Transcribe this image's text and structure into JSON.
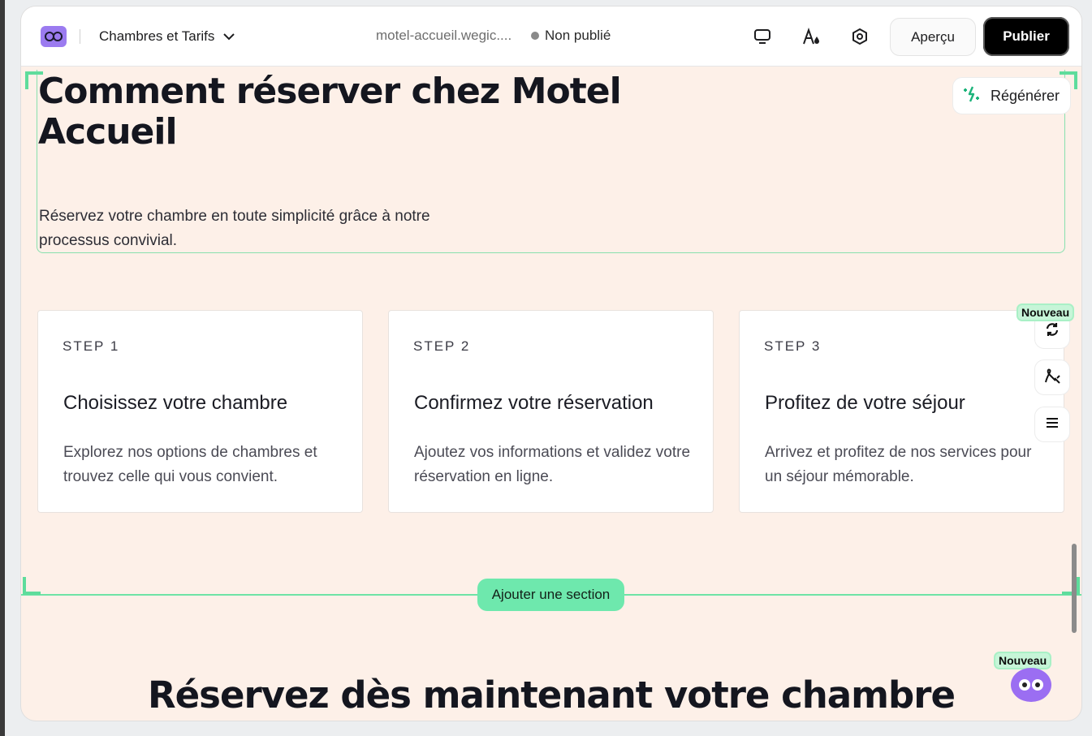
{
  "topbar": {
    "page_name": "Chambres et Tarifs",
    "url": "motel-accueil.wegic....",
    "status": "Non publié",
    "preview_label": "Aperçu",
    "publish_label": "Publier"
  },
  "hero": {
    "title": "Comment réserver chez Motel Accueil",
    "subtitle": "Réservez votre chambre en toute simplicité grâce à notre processus convivial.",
    "regenerate_label": "Régénérer"
  },
  "steps": [
    {
      "step": "STEP 1",
      "title": "Choisissez votre chambre",
      "desc": "Explorez nos options de chambres et trouvez celle qui vous convient."
    },
    {
      "step": "STEP 2",
      "title": "Confirmez votre réservation",
      "desc": "Ajoutez vos informations et validez votre réservation en ligne."
    },
    {
      "step": "STEP 3",
      "title": "Profitez de votre séjour",
      "desc": "Arrivez et profitez de nos services pour un séjour mémorable."
    }
  ],
  "side_tools": {
    "badge": "Nouveau",
    "icons": [
      "refresh-icon",
      "magic-edit-icon",
      "menu-icon"
    ]
  },
  "add_section_label": "Ajouter une section",
  "next_section_title": "Réservez dès maintenant votre chambre",
  "assistant_badge": "Nouveau",
  "colors": {
    "accent": "#6ee8ad",
    "canvas": "#fdf0e8",
    "brand": "#9b7bf0"
  }
}
